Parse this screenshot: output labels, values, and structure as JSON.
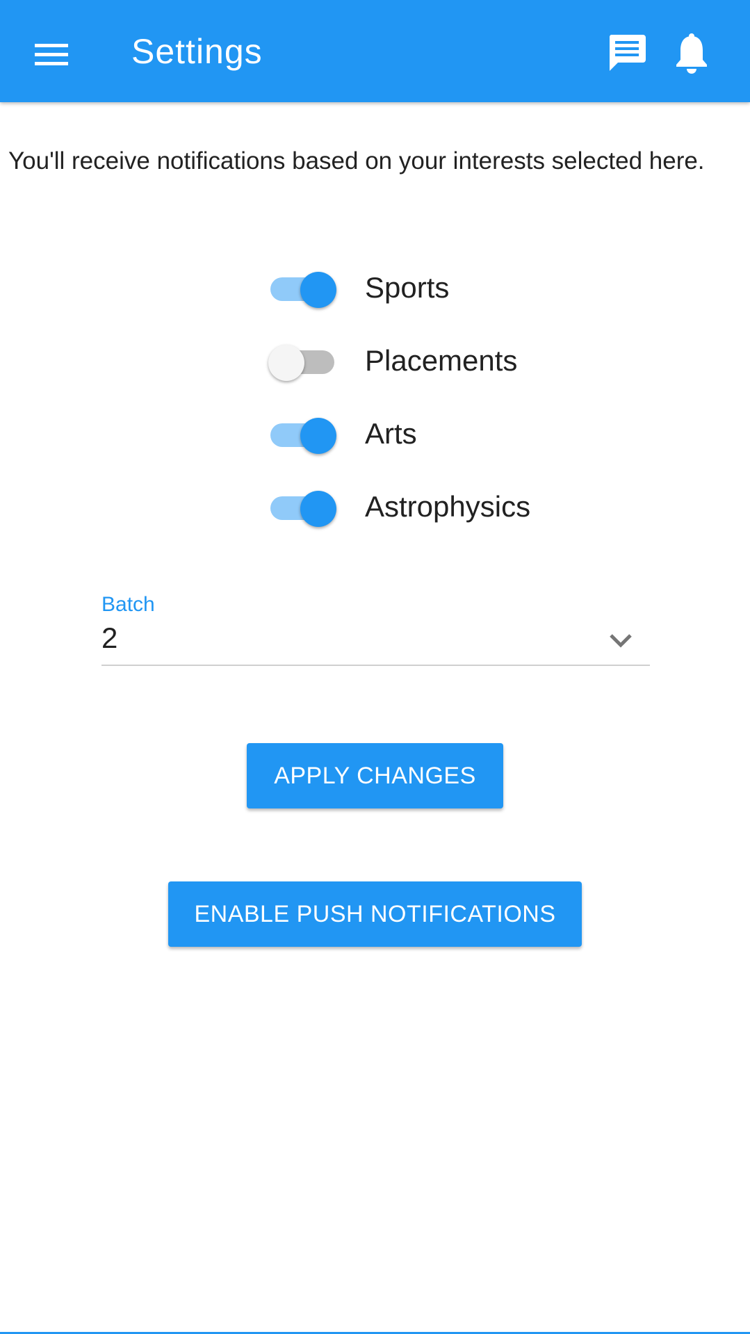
{
  "app_bar": {
    "title": "Settings",
    "menu_icon": "hamburger-menu-icon",
    "chat_icon": "chat-message-icon",
    "bell_icon": "notification-bell-icon",
    "color": "#2196f3"
  },
  "intro_text": "You'll receive notifications based on your interests selected here.",
  "interests": [
    {
      "label": "Sports",
      "enabled": true
    },
    {
      "label": "Placements",
      "enabled": false
    },
    {
      "label": "Arts",
      "enabled": true
    },
    {
      "label": "Astrophysics",
      "enabled": true
    }
  ],
  "batch_select": {
    "label": "Batch",
    "value": "2",
    "icon": "chevron-down-icon"
  },
  "buttons": {
    "apply": "APPLY CHANGES",
    "enable_push": "ENABLE PUSH NOTIFICATIONS"
  },
  "colors": {
    "accent": "#2196f3",
    "toggle_track_on": "#90caf9",
    "toggle_track_off": "#bdbdbd"
  }
}
